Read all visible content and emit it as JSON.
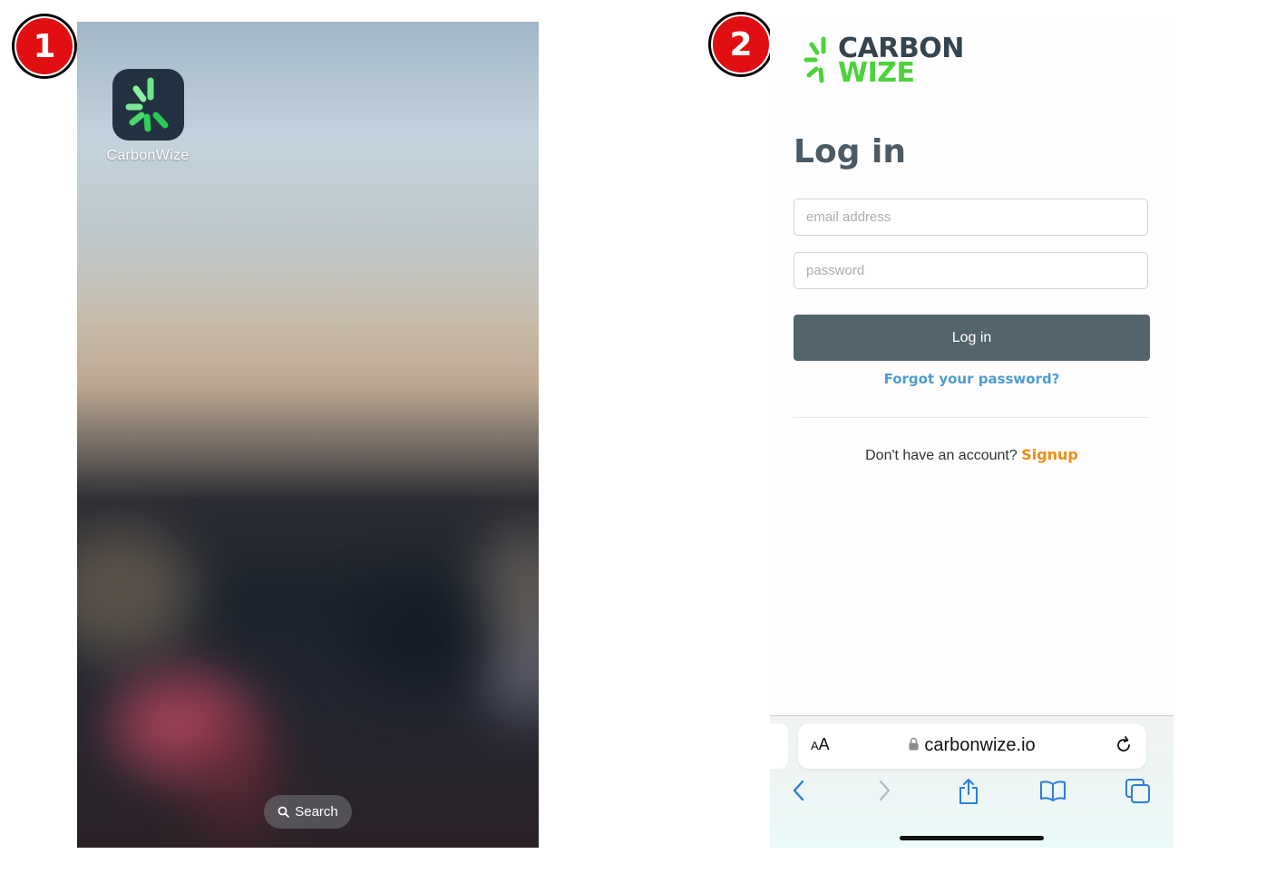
{
  "steps": {
    "first": "1",
    "second": "2"
  },
  "home_screen": {
    "app": {
      "label": "CarbonWize",
      "icon": "carbonwize-burst-icon"
    },
    "search_label": "Search"
  },
  "web_page": {
    "logo": {
      "line1": "CARBON",
      "line2": "WIZE",
      "colors": {
        "dark": "#35444f",
        "green": "#4cd23c"
      }
    },
    "title": "Log in",
    "email_placeholder": "email address",
    "password_placeholder": "password",
    "login_button": "Log in",
    "forgot_link": "Forgot your password?",
    "signup_prompt": "Don't have an account?",
    "signup_link": "Signup"
  },
  "browser": {
    "text_size_label_small": "A",
    "text_size_label_large": "A",
    "url": "carbonwize.io",
    "toolbar_icons": [
      "back-icon",
      "forward-icon",
      "share-icon",
      "bookmarks-icon",
      "tabs-icon"
    ]
  },
  "colors": {
    "badge": "#e10e12",
    "button": "#54646d",
    "link": "#4e9dd1",
    "signup": "#f08c12"
  }
}
